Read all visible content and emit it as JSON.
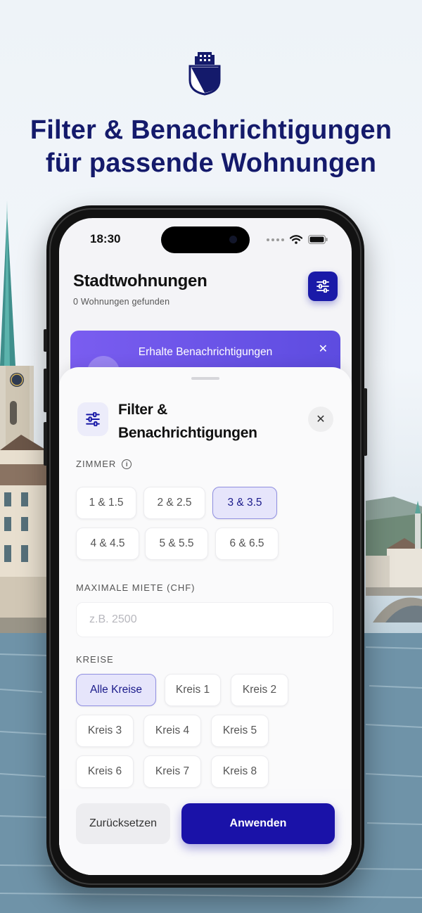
{
  "hero": {
    "headline_line1": "Filter & Benachrichtigungen",
    "headline_line2": "für passende Wohnungen",
    "logo_icon": "zurich-shield-building-icon"
  },
  "status_bar": {
    "time": "18:30",
    "icons": [
      "signal-dots-icon",
      "wifi-icon",
      "battery-icon"
    ]
  },
  "app": {
    "title": "Stadtwohnungen",
    "subtitle": "0 Wohnungen gefunden",
    "filter_icon": "sliders-icon"
  },
  "promo": {
    "title": "Erhalte Benachrichtigungen",
    "close_icon": "close-icon"
  },
  "sheet": {
    "title": "Filter & Benachrichtigungen",
    "icon": "sliders-icon",
    "close_icon": "close-icon",
    "rooms": {
      "label": "ZIMMER",
      "info_icon": "info-icon",
      "options": [
        {
          "label": "1 & 1.5",
          "selected": false
        },
        {
          "label": "2 & 2.5",
          "selected": false
        },
        {
          "label": "3 & 3.5",
          "selected": true
        },
        {
          "label": "4 & 4.5",
          "selected": false
        },
        {
          "label": "5 & 5.5",
          "selected": false
        },
        {
          "label": "6 & 6.5",
          "selected": false
        }
      ]
    },
    "rent": {
      "label": "MAXIMALE MIETE (CHF)",
      "value": "",
      "placeholder": "z.B. 2500"
    },
    "districts": {
      "label": "KREISE",
      "options": [
        {
          "label": "Alle Kreise",
          "selected": true
        },
        {
          "label": "Kreis 1",
          "selected": false
        },
        {
          "label": "Kreis 2",
          "selected": false
        },
        {
          "label": "Kreis 3",
          "selected": false
        },
        {
          "label": "Kreis 4",
          "selected": false
        },
        {
          "label": "Kreis 5",
          "selected": false
        },
        {
          "label": "Kreis 6",
          "selected": false
        },
        {
          "label": "Kreis 7",
          "selected": false
        },
        {
          "label": "Kreis 8",
          "selected": false
        }
      ]
    },
    "reset_label": "Zurücksetzen",
    "apply_label": "Anwenden"
  },
  "colors": {
    "brand_navy": "#141a6b",
    "accent": "#1a12a8",
    "promo": "#6a55e8",
    "selected_chip_bg": "#e6e5fb"
  }
}
